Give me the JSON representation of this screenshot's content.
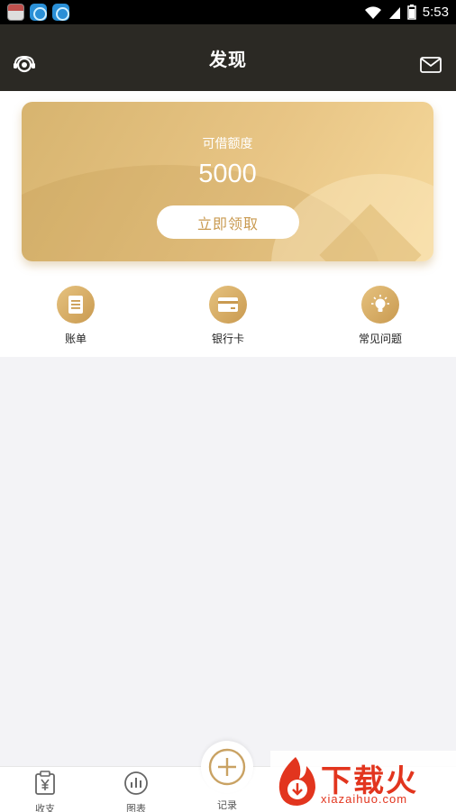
{
  "status_bar": {
    "time": "5:53"
  },
  "header": {
    "title": "发现"
  },
  "credit_card": {
    "label": "可借额度",
    "amount": "5000",
    "claim_label": "立即领取"
  },
  "quick_entries": [
    {
      "label": "账单",
      "icon": "bill-icon"
    },
    {
      "label": "银行卡",
      "icon": "bank-card-icon"
    },
    {
      "label": "常见问题",
      "icon": "lightbulb-icon"
    }
  ],
  "bottom_nav": {
    "items": [
      {
        "label": "收支",
        "icon": "receipt-icon"
      },
      {
        "label": "图表",
        "icon": "chart-icon"
      },
      {
        "label": "记录",
        "icon": "plus-icon"
      }
    ]
  },
  "watermark": {
    "text": "下载火",
    "url": "xiazaihuo.com"
  },
  "colors": {
    "header_bg": "#2b2924",
    "gold": "#c99a50",
    "page_bg": "#f3f3f6"
  }
}
